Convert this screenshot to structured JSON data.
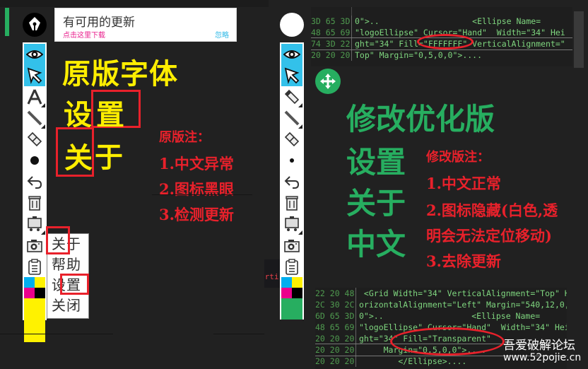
{
  "notification": {
    "title": "有可用的更新",
    "download_link": "点击这里下载",
    "ignore_link": "忽略"
  },
  "left": {
    "heading": "原版字体",
    "settings_label": "设置",
    "settings_chars": [
      "设",
      "置"
    ],
    "about_chars": [
      "关",
      "于"
    ],
    "notes_title": "原版注：",
    "notes": [
      "1.中文异常",
      "2.图标黑眼",
      "3.检测更新"
    ],
    "menu_items": [
      {
        "label": "关于"
      },
      {
        "label": "帮助"
      },
      {
        "label": "设置"
      },
      {
        "label": "关闭"
      }
    ],
    "partial_text": "erti"
  },
  "right": {
    "heading": "修改优化版",
    "lines": [
      "设置",
      "关于",
      "中文"
    ],
    "notes_title": "修改版注：",
    "notes": [
      "1.中文正常",
      "2.图标隐藏(白色,透",
      "明会无法定位移动)",
      "3.去除更新"
    ]
  },
  "toolbar": {
    "left_tools": [
      "eye-icon",
      "cursor-icon",
      "text-icon",
      "line-icon",
      "eraser-icon",
      "dot-icon",
      "undo-icon",
      "trash-icon",
      "board-icon",
      "camera-icon",
      "clipboard-icon"
    ],
    "right_tools": [
      "eye-icon",
      "cursor-icon",
      "highlighter-icon",
      "line-icon",
      "eraser-icon",
      "dot-icon",
      "undo-icon",
      "trash-icon",
      "board-icon",
      "camera-icon",
      "clipboard-icon"
    ],
    "palette": [
      "#00aeef",
      "#fff200",
      "#ec008c",
      "#000000"
    ],
    "left_current_color": "#fff200",
    "right_current_color": "#27ae60"
  },
  "hex_top": {
    "rows": [
      {
        "off": "3D 65 3D",
        "txt": "0\">..                   <Ellipse Name="
      },
      {
        "off": "48 65 69",
        "txt": "\"logoEllipse\" Cursor=\"Hand\"  Width=\"34\" Hei"
      },
      {
        "off": "74 3D 22",
        "txt": "ght=\"34\" Fill=\"FFFFFFF\" VerticalAlignment=\""
      },
      {
        "off": "20 20 20",
        "txt": "Top\" Margin=\"0,5,0,0\">...."
      }
    ],
    "highlight": "FFFFFFF"
  },
  "hex_bottom": {
    "rows": [
      {
        "off": "22 20 48",
        "txt": " <Grid Width=\"34\" VerticalAlignment=\"Top\" H"
      },
      {
        "off": "2C 30 2C",
        "txt": "orizontalAlignment=\"Left\" Margin=\"540,12,0,"
      },
      {
        "off": "6D 65 3D",
        "txt": "0\">..                  <Ellipse Name="
      },
      {
        "off": "48 65 69",
        "txt": "\"logoEllipse\" Cursor=\"Hand\"  Width=\"34\" Hei"
      },
      {
        "off": "20 20 20",
        "txt": "ght=\"34\" Fill=\"Transparent\""
      },
      {
        "off": "20 20 20",
        "txt": "     Margin=\"0,5,0,0\">...."
      },
      {
        "off": "20 20 20",
        "txt": "        </Ellipse>...."
      }
    ],
    "highlight": "Transparent"
  },
  "watermark": {
    "title": "吾爱破解论坛",
    "url": "www.52pojie.cn"
  }
}
